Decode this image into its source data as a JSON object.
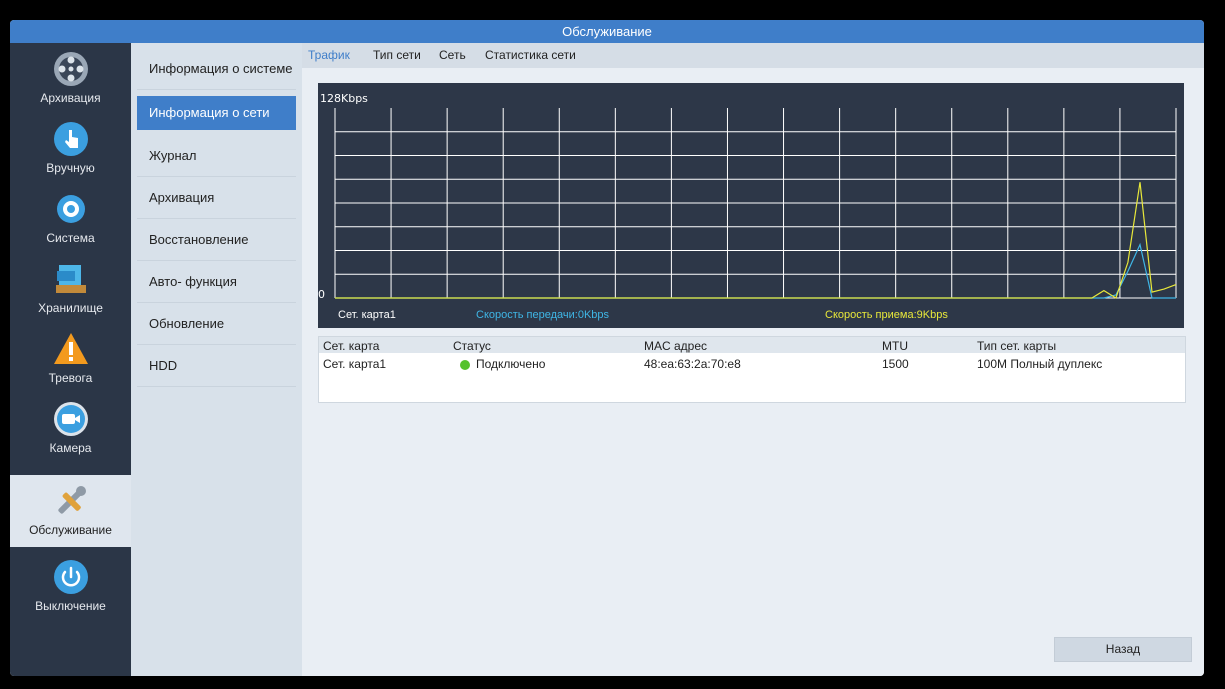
{
  "window": {
    "title": "Обслуживание"
  },
  "left_nav": [
    {
      "label": "Архивация",
      "icon": "film-reel-icon"
    },
    {
      "label": "Вручную",
      "icon": "hand-pointer-icon"
    },
    {
      "label": "Система",
      "icon": "gear-icon"
    },
    {
      "label": "Хранилище",
      "icon": "storage-icon"
    },
    {
      "label": "Тревога",
      "icon": "alarm-warning-icon"
    },
    {
      "label": "Камера",
      "icon": "camera-icon"
    },
    {
      "label": "Обслуживание",
      "icon": "tools-icon",
      "active": true
    },
    {
      "label": "Выключение",
      "icon": "power-icon"
    }
  ],
  "sub_nav": [
    {
      "label": "Информация о системе"
    },
    {
      "label": "Информация о сети",
      "active": true
    },
    {
      "label": "Журнал"
    },
    {
      "label": "Архивация"
    },
    {
      "label": "Восстановление"
    },
    {
      "label": "Авто- функция"
    },
    {
      "label": "Обновление"
    },
    {
      "label": "HDD"
    }
  ],
  "tabs": [
    {
      "label": "Трафик",
      "active": true
    },
    {
      "label": "Тип сети"
    },
    {
      "label": "Сеть"
    },
    {
      "label": "Статистика сети"
    }
  ],
  "graph": {
    "y_max_label": "128Kbps",
    "y_min_label": "0",
    "card_label": "Сет. карта1",
    "send_label": "Скорость передачи:0Kbps",
    "recv_label": "Скорость приема:9Kbps",
    "send_color": "#3fb6e6",
    "recv_color": "#e8e83a",
    "grid_on": true
  },
  "chart_data": {
    "type": "line",
    "ylim": [
      0,
      128
    ],
    "series": [
      {
        "name": "Скорость передачи",
        "color": "#3fb6e6",
        "values": [
          0,
          0,
          0,
          0,
          0,
          0,
          0,
          0,
          0,
          0,
          0,
          0,
          0,
          0,
          0,
          0,
          0,
          0,
          0,
          0,
          0,
          0,
          0,
          0,
          0,
          0,
          0,
          0,
          0,
          0,
          0,
          0,
          0,
          0,
          0,
          0,
          0,
          0,
          0,
          0,
          0,
          0,
          0,
          0,
          0,
          0,
          0,
          0,
          0,
          0,
          0,
          0,
          0,
          0,
          0,
          0,
          0,
          0,
          0,
          0,
          0,
          0,
          0,
          0,
          0,
          2,
          18,
          36,
          0,
          0,
          0
        ]
      },
      {
        "name": "Скорость приема",
        "color": "#e8e83a",
        "values": [
          0,
          0,
          0,
          0,
          0,
          0,
          0,
          0,
          0,
          0,
          0,
          0,
          0,
          0,
          0,
          0,
          0,
          0,
          0,
          0,
          0,
          0,
          0,
          0,
          0,
          0,
          0,
          0,
          0,
          0,
          0,
          0,
          0,
          0,
          0,
          0,
          0,
          0,
          0,
          0,
          0,
          0,
          0,
          0,
          0,
          0,
          0,
          0,
          0,
          0,
          0,
          0,
          0,
          0,
          0,
          0,
          0,
          0,
          0,
          0,
          0,
          0,
          0,
          0,
          5,
          0,
          24,
          78,
          4,
          6,
          9
        ]
      }
    ]
  },
  "table": {
    "headers": [
      "Сет. карта",
      "Статус",
      "MAC адрес",
      "MTU",
      "Тип сет. карты"
    ],
    "rows": [
      {
        "card": "Сет. карта1",
        "status": "Подключено",
        "status_color": "#55c22d",
        "mac": "48:ea:63:2a:70:e8",
        "mtu": "1500",
        "type": "100M Полный дуплекс"
      }
    ]
  },
  "back_button": {
    "label": "Назад"
  }
}
